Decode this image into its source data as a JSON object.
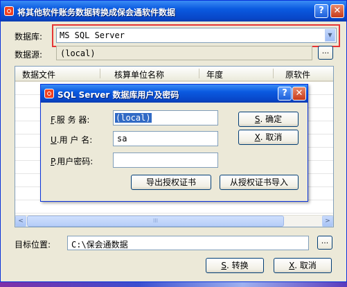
{
  "window": {
    "title": "将其他软件账务数据转换成保会通软件数据",
    "help": "?",
    "close": "✕"
  },
  "database": {
    "label": "数据库:",
    "value": "MS SQL Server",
    "arrow": "▼"
  },
  "datasource": {
    "label": "数据源:",
    "value": "(local)",
    "button": "..."
  },
  "table": {
    "columns": [
      "数据文件",
      "核算单位名称",
      "年度",
      "原软件"
    ]
  },
  "scrollbar": {
    "left": "<",
    "right": ">",
    "thumb": "III"
  },
  "target": {
    "label": "目标位置:",
    "value": "C:\\保会通数据",
    "button": "..."
  },
  "buttons": {
    "convert_key": "S",
    "convert": ". 转换",
    "cancel_key": "X",
    "cancel": ". 取消"
  },
  "dialog": {
    "title": "SQL Server 数据库用户及密码",
    "help": "?",
    "close": "✕",
    "server_key": "F",
    "server_label": ".服 务 器:",
    "server_value": "(local)",
    "user_key": "U",
    "user_label": ".用 户 名:",
    "user_value": "sa",
    "password_key": "P",
    "password_label": ".用户密码:",
    "password_value": "",
    "ok_key": "S",
    "ok": ". 确定",
    "cancel_key": "X",
    "cancel": ". 取消",
    "export_cert": "导出授权证书",
    "import_cert": "从授权证书导入"
  }
}
